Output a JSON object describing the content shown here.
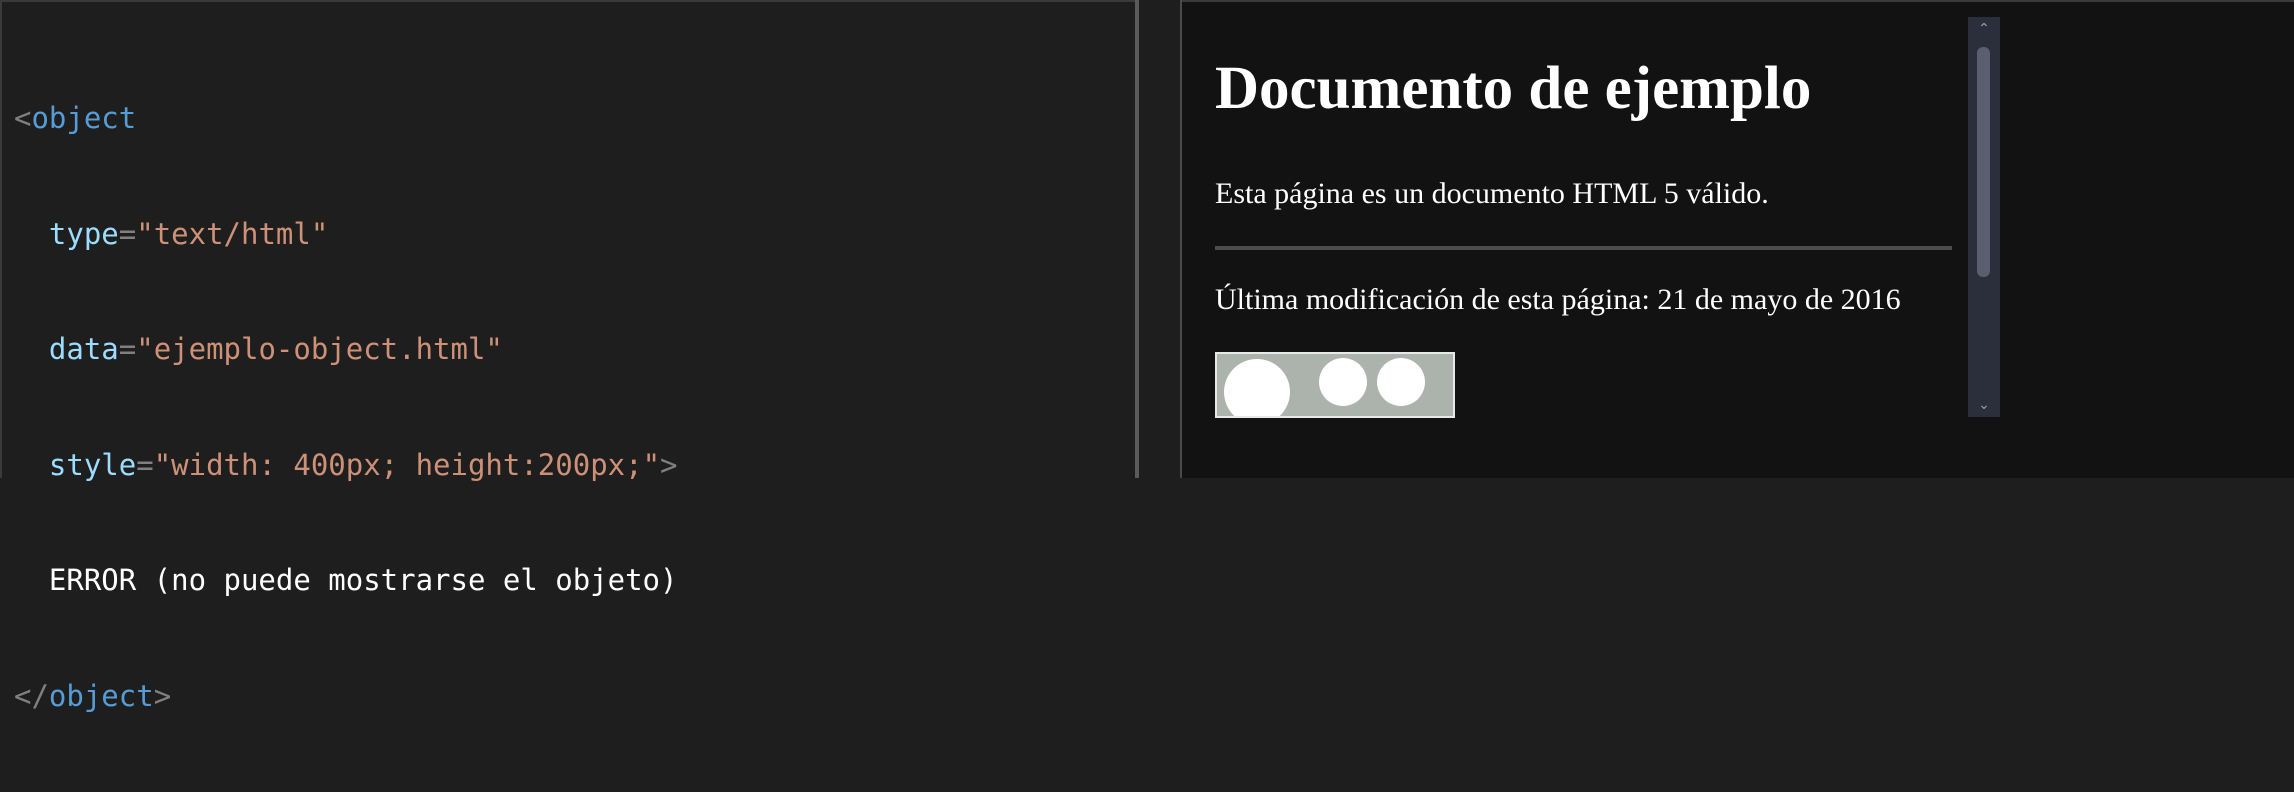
{
  "editor": {
    "lines": [
      {
        "open": "<",
        "tag": "object",
        "close": ""
      },
      {
        "attr": "type",
        "eq": "=",
        "val": "\"text/html\""
      },
      {
        "attr": "data",
        "eq": "=",
        "val": "\"ejemplo-object.html\""
      },
      {
        "attr": "style",
        "eq": "=",
        "val": "\"width: 400px; height:200px;\"",
        "end": ">"
      },
      {
        "text": "ERROR (no puede mostrarse el objeto)"
      },
      {
        "open": "</",
        "tag": "object",
        "close": ">"
      }
    ]
  },
  "preview": {
    "heading": "Documento de ejemplo",
    "paragraph": "Esta página es un documento HTML 5 válido.",
    "modified": "Última modificación de esta página: 21 de mayo de 2016"
  },
  "scrollbar": {
    "up_icon": "chevron-up-icon",
    "down_icon": "chevron-down-icon"
  },
  "colors": {
    "editor_bg": "#1e1e1e",
    "preview_bg": "#121212",
    "tag": "#569cd6",
    "attribute": "#9cdcfe",
    "string": "#ce9178"
  }
}
